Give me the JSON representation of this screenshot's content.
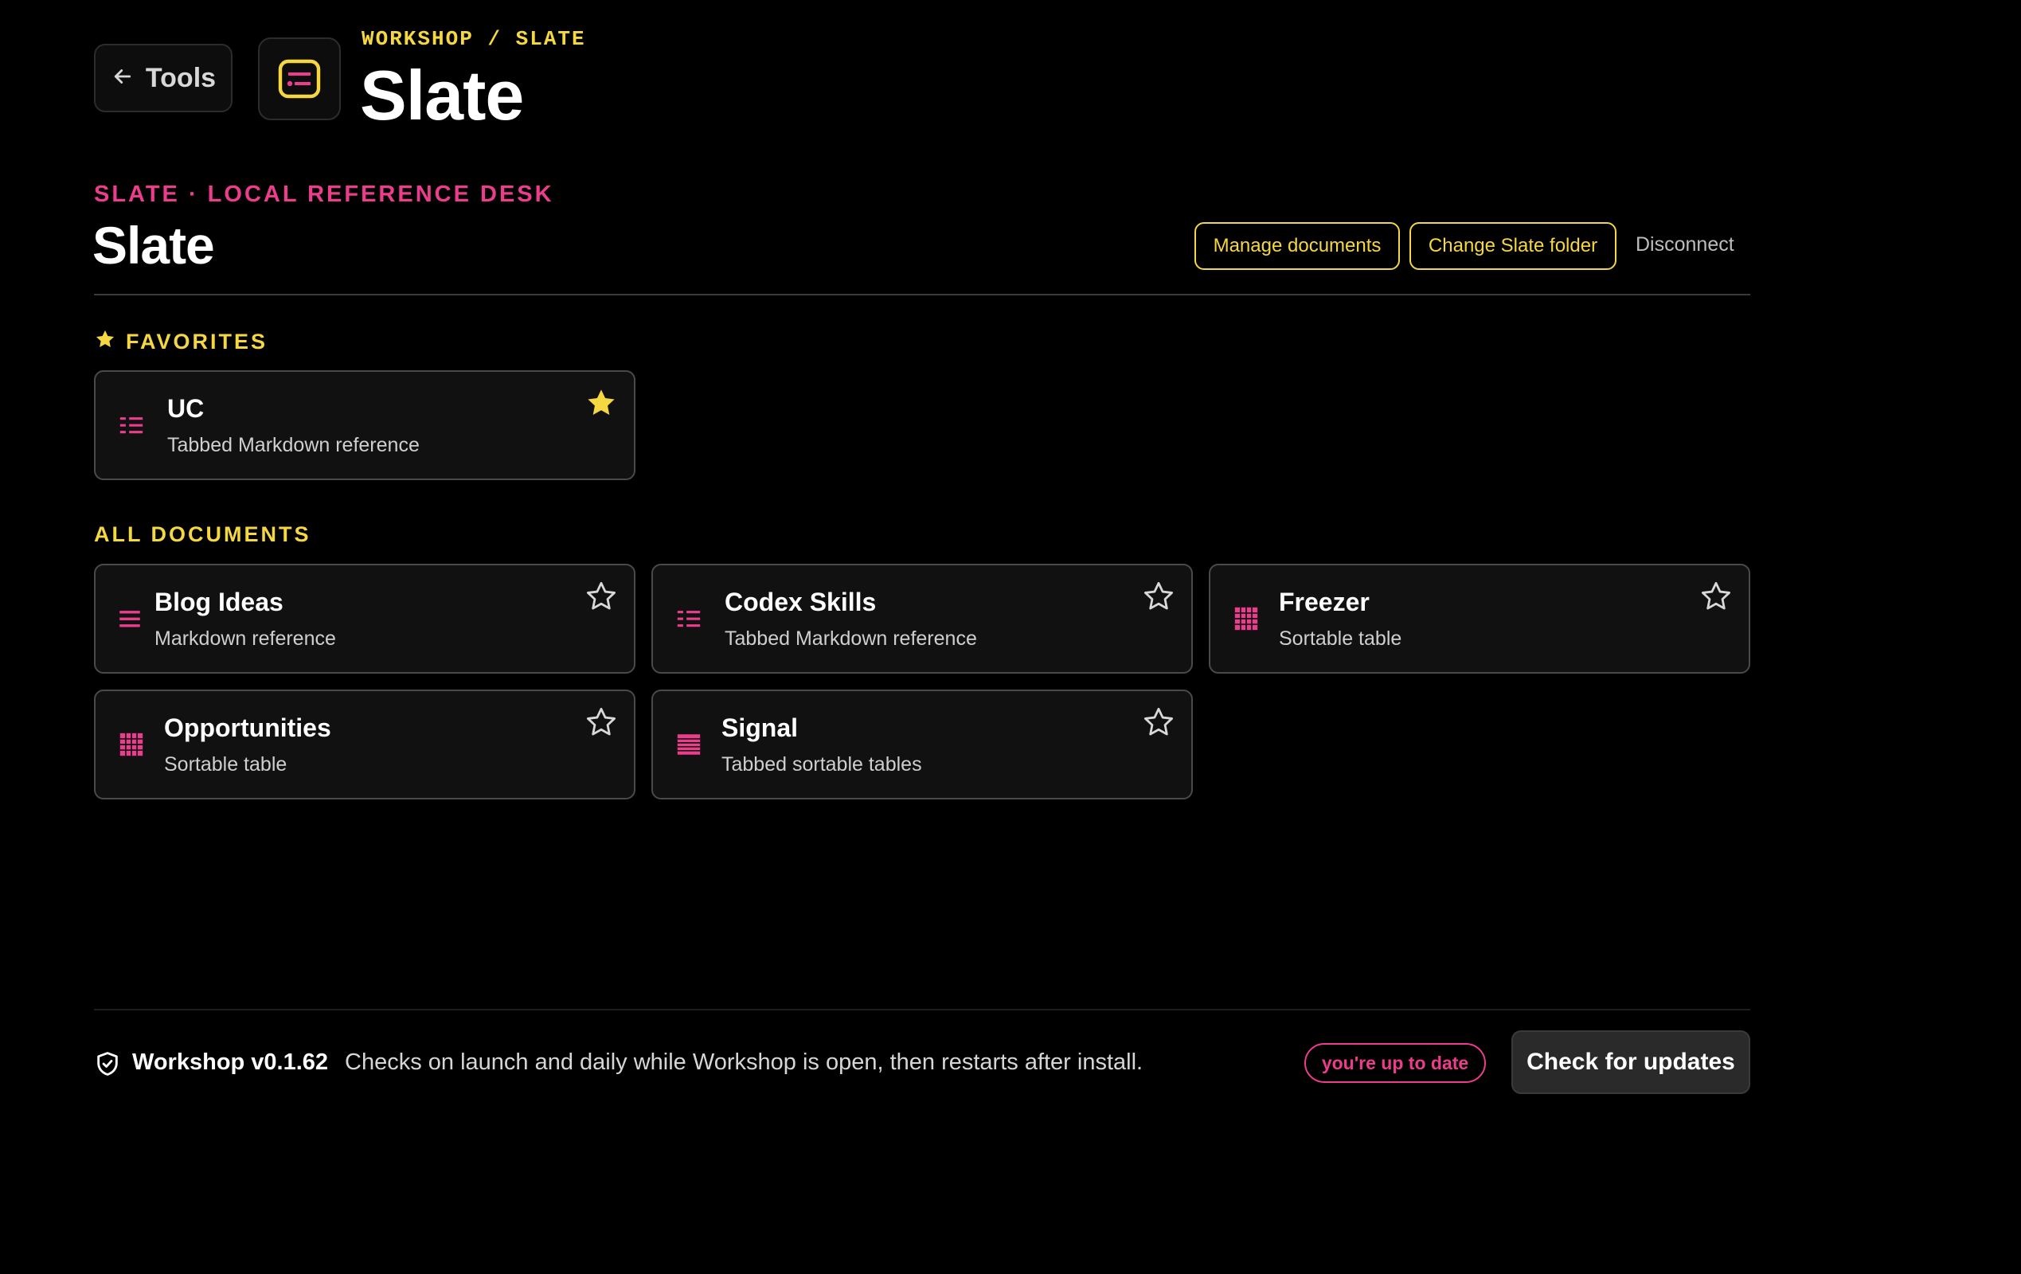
{
  "header": {
    "back_label": "Tools",
    "breadcrumb": "WORKSHOP / SLATE",
    "title": "Slate"
  },
  "section": {
    "eyebrow": "SLATE · LOCAL REFERENCE DESK",
    "title": "Slate",
    "actions": {
      "manage": "Manage documents",
      "change_folder": "Change Slate folder",
      "disconnect": "Disconnect"
    }
  },
  "favorites": {
    "label": "FAVORITES",
    "items": [
      {
        "title": "UC",
        "subtitle": "Tabbed Markdown reference",
        "icon": "tabbed-markdown-icon",
        "favorited": true
      }
    ]
  },
  "documents": {
    "label": "ALL DOCUMENTS",
    "items": [
      {
        "title": "Blog Ideas",
        "subtitle": "Markdown reference",
        "icon": "markdown-icon",
        "favorited": false
      },
      {
        "title": "Codex Skills",
        "subtitle": "Tabbed Markdown reference",
        "icon": "tabbed-markdown-icon",
        "favorited": false
      },
      {
        "title": "Freezer",
        "subtitle": "Sortable table",
        "icon": "table-icon",
        "favorited": false
      },
      {
        "title": "Opportunities",
        "subtitle": "Sortable table",
        "icon": "table-icon",
        "favorited": false
      },
      {
        "title": "Signal",
        "subtitle": "Tabbed sortable tables",
        "icon": "tabbed-table-icon",
        "favorited": false
      }
    ]
  },
  "footer": {
    "version": "Workshop v0.1.62",
    "note": "Checks on launch and daily while Workshop is open, then restarts after install.",
    "status": "you're up to date",
    "check_label": "Check for updates"
  },
  "colors": {
    "accent_yellow": "#f5d742",
    "accent_pink": "#ec3d8c",
    "background": "#000000",
    "card_bg": "#111111"
  }
}
